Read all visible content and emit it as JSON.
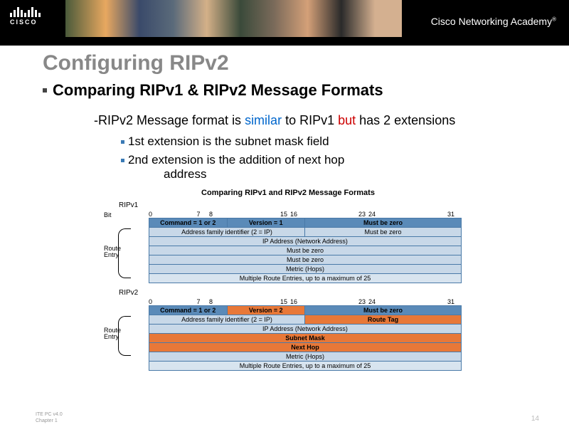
{
  "banner": {
    "logo_text": "CISCO",
    "academy": "Cisco Networking Academy"
  },
  "title": "Configuring RIPv2",
  "subtitle": "Comparing RIPv1 & RIPv2  Message Formats",
  "body_pre": "-RIPv2 Message format is ",
  "body_similar": "similar",
  "body_mid": " to RIPv1 ",
  "body_but": "but",
  "body_post": " has 2 extensions",
  "bullet1": "1st extension is the subnet mask field",
  "bullet2a": "2nd extension is the addition of next hop",
  "bullet2b": "address",
  "diagram": {
    "title": "Comparing RIPv1 and RIPv2 Message Formats",
    "bit_label": "Bit",
    "bits": [
      "0",
      "7",
      "8",
      "15",
      "16",
      "23",
      "24",
      "31"
    ],
    "route_entry": "Route\nEntry",
    "ripv1": {
      "label": "RIPv1",
      "r0": [
        "Command = 1 or 2",
        "Version = 1",
        "Must be zero"
      ],
      "r1": [
        "Address family identifier (2 = IP)",
        "Must be zero"
      ],
      "r2": "IP Address (Network Address)",
      "r3": "Must be zero",
      "r4": "Must be zero",
      "r5": "Metric (Hops)",
      "r6": "Multiple Route Entries, up to a maximum of 25"
    },
    "ripv2": {
      "label": "RIPv2",
      "r0": [
        "Command = 1 or 2",
        "Version = 2",
        "Must be zero"
      ],
      "r1": [
        "Address family identifier (2 = IP)",
        "Route Tag"
      ],
      "r2": "IP Address (Network Address)",
      "r3": "Subnet Mask",
      "r4": "Next Hop",
      "r5": "Metric (Hops)",
      "r6": "Multiple Route Entries, up to a maximum of 25"
    }
  },
  "footer": {
    "left1": "ITE PC v4.0",
    "left2": "Chapter 1",
    "page": "14"
  }
}
